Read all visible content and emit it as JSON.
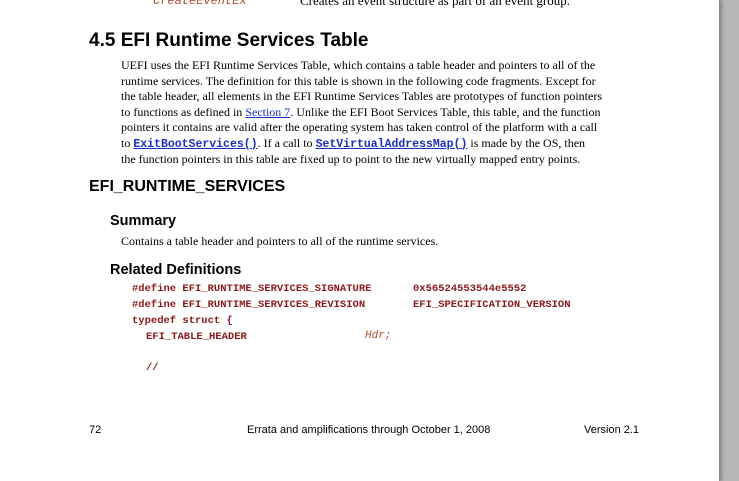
{
  "top_row": {
    "code": "CreateEventEx",
    "description": "Creates an event structure as part of an event group."
  },
  "section": {
    "title": "4.5 EFI Runtime Services Table",
    "para_l1": "UEFI uses the EFI Runtime Services Table, which contains a table header and pointers to all of the",
    "para_l2": "runtime services.  The definition for this table is shown in the following code fragments.  Except for",
    "para_l3": "the table header, all elements in the EFI Runtime Services Tables are prototypes of function pointers",
    "para_l4_pre": "to functions as defined in ",
    "para_l4_link": "Section 7",
    "para_l4_post": ".  Unlike the EFI Boot Services Table, this table, and the function",
    "para_l5": "pointers it contains are valid after the operating system has taken control of the platform with a call",
    "para_l6_pre": "to ",
    "para_l6_link1": "ExitBootServices()",
    "para_l6_mid": ".  If a call to ",
    "para_l6_link2": "SetVirtualAddressMap()",
    "para_l6_post": " is made by the OS, then",
    "para_l7": "the function pointers in this table are fixed up to point to the new virtually mapped entry points."
  },
  "api": {
    "name": "EFI_RUNTIME_SERVICES",
    "summary_heading": "Summary",
    "summary_text": "Contains a table header and pointers to all of the runtime services.",
    "related_heading": "Related Definitions",
    "code": {
      "define1_kw": "#define EFI_RUNTIME_SERVICES_SIGNATURE",
      "define1_val": "0x56524553544e5552",
      "define2_kw": "#define EFI_RUNTIME_SERVICES_REVISION",
      "define2_val": "EFI_SPECIFICATION_VERSION",
      "typedef": "typedef struct {",
      "field_type": "EFI_TABLE_HEADER",
      "field_name": "Hdr;",
      "comment": "//"
    }
  },
  "footer": {
    "page_number": "72",
    "center": "Errata and amplifications through October 1, 2008",
    "version": "Version 2.1"
  }
}
